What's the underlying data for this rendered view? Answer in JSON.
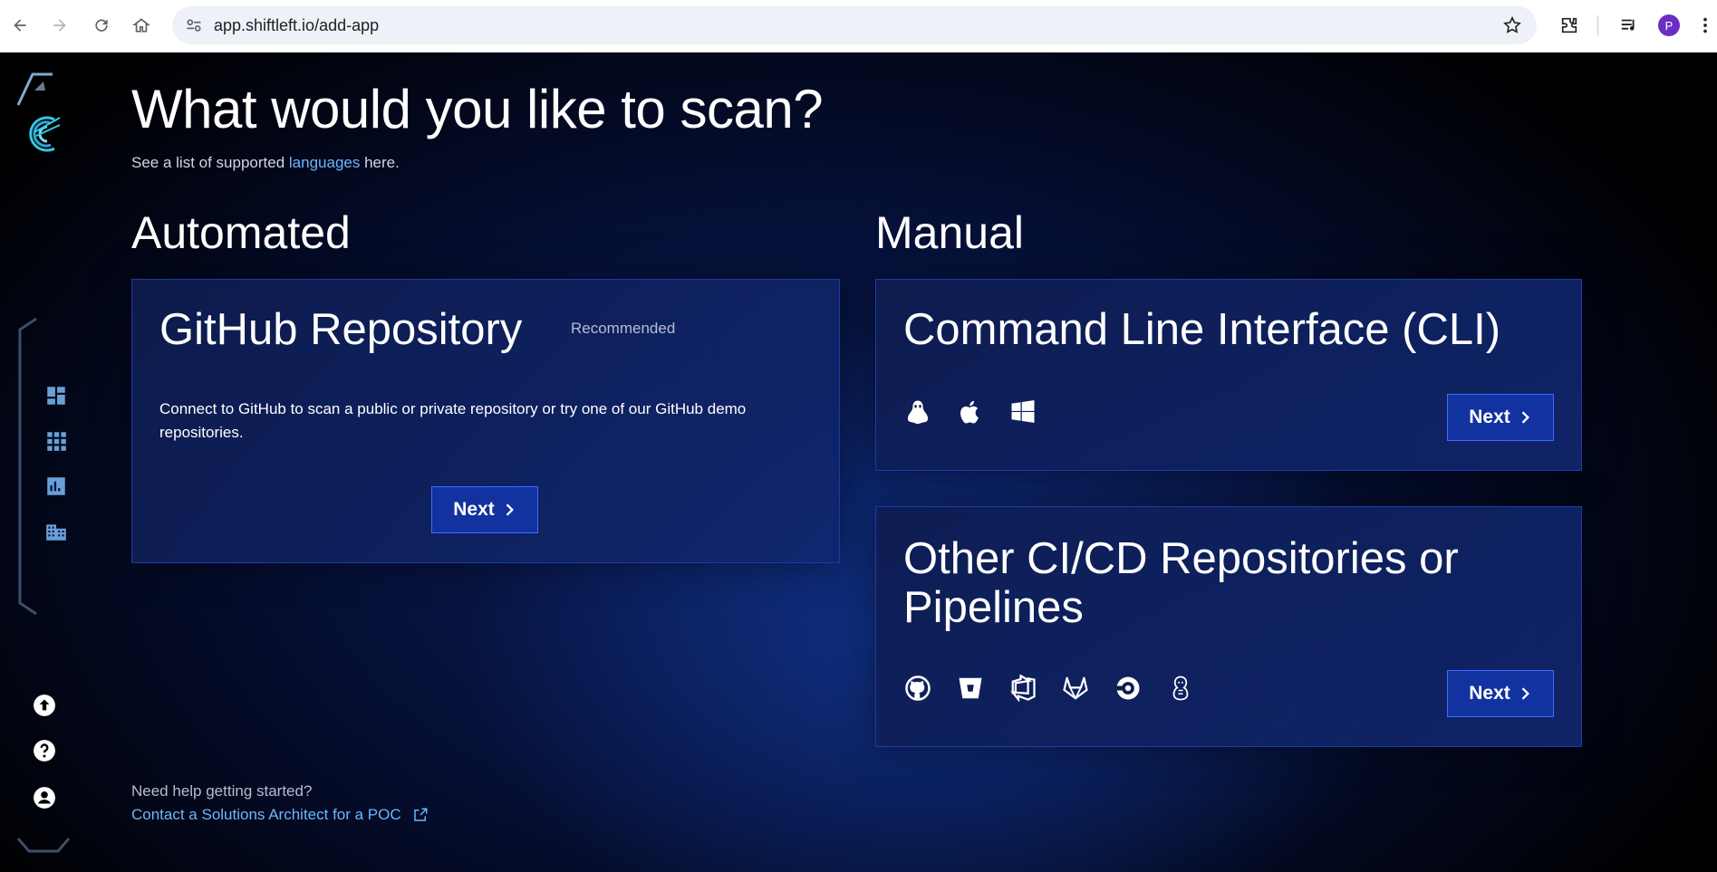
{
  "browser": {
    "url": "app.shiftleft.io/add-app",
    "profile_initial": "P"
  },
  "page": {
    "title": "What would you like to scan?",
    "subtitle_prefix": "See a list of supported ",
    "subtitle_link": "languages",
    "subtitle_suffix": " here."
  },
  "automated": {
    "heading": "Automated",
    "github_card": {
      "title": "GitHub Repository",
      "badge": "Recommended",
      "description": "Connect to GitHub to scan a public or private repository or try one of our GitHub demo repositories.",
      "next_label": "Next"
    }
  },
  "manual": {
    "heading": "Manual",
    "cli_card": {
      "title": "Command Line Interface (CLI)",
      "icons": [
        "linux-icon",
        "apple-icon",
        "windows-icon"
      ],
      "next_label": "Next"
    },
    "cicd_card": {
      "title": "Other CI/CD Repositories or Pipelines",
      "icons": [
        "github-icon",
        "bitbucket-icon",
        "azure-devops-icon",
        "gitlab-icon",
        "circleci-icon",
        "jenkins-icon"
      ],
      "next_label": "Next"
    }
  },
  "help": {
    "label": "Need help getting started?",
    "link": "Contact a Solutions Architect for a POC"
  },
  "sidebar": {
    "items": [
      "dashboard-icon",
      "apps-grid-icon",
      "reports-icon",
      "organization-icon"
    ],
    "bottom": [
      "upload-icon",
      "help-icon",
      "account-icon"
    ]
  },
  "colors": {
    "accent_link": "#6cb6ff",
    "button_bg": "#1232a0",
    "card_border": "#1e3aa8"
  }
}
